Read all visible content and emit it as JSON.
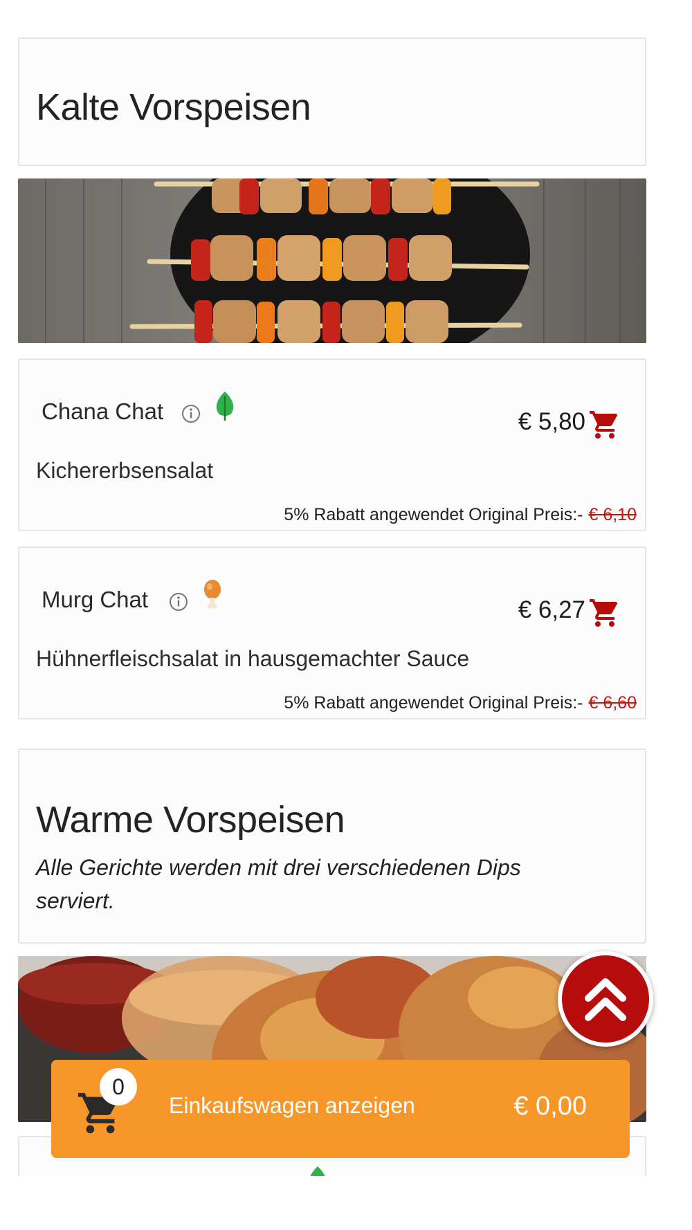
{
  "sections": [
    {
      "title": "Kalte Vorspeisen",
      "items": [
        {
          "name": "Chana Chat",
          "diet_icon": "leaf-icon",
          "price": "€ 5,80",
          "description": "Kichererbsensalat",
          "discount_text": "5% Rabatt angewendet Original Preis:-",
          "original_price": "€ 6,10"
        },
        {
          "name": "Murg Chat",
          "diet_icon": "chicken-leg-icon",
          "price": "€ 6,27",
          "description": "Hühnerfleischsalat in hausgemachter Sauce",
          "discount_text": "5% Rabatt angewendet Original Preis:-",
          "original_price": "€ 6,60"
        }
      ]
    },
    {
      "title": "Warme Vorspeisen",
      "description": "Alle Gerichte werden mit drei verschiedenen Dips serviert."
    }
  ],
  "cart": {
    "count": "0",
    "label": "Einkaufswagen anzeigen",
    "total": "€ 0,00"
  },
  "colors": {
    "accent_red": "#b70c0c",
    "cart_orange": "#f7972a",
    "veg_green": "#2fb24a",
    "nonveg_orange": "#e88a2e"
  }
}
